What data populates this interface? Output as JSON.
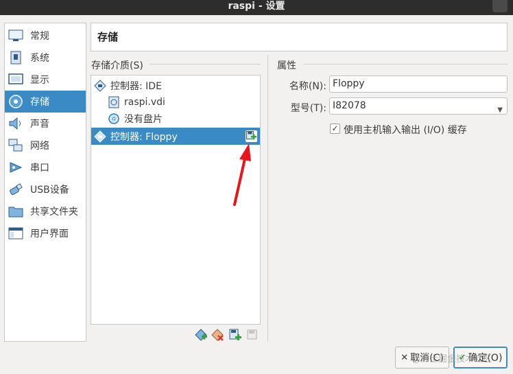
{
  "window": {
    "title": "raspi - 设置"
  },
  "sidebar": {
    "items": [
      {
        "label": "常规",
        "icon": "general-icon"
      },
      {
        "label": "系统",
        "icon": "system-chip-icon"
      },
      {
        "label": "显示",
        "icon": "monitor-icon"
      },
      {
        "label": "存储",
        "icon": "disk-icon",
        "selected": true
      },
      {
        "label": "声音",
        "icon": "speaker-icon"
      },
      {
        "label": "网络",
        "icon": "network-icon"
      },
      {
        "label": "串口",
        "icon": "serial-port-icon"
      },
      {
        "label": "USB设备",
        "icon": "usb-icon"
      },
      {
        "label": "共享文件夹",
        "icon": "folder-icon"
      },
      {
        "label": "用户界面",
        "icon": "ui-window-icon"
      }
    ]
  },
  "page": {
    "title": "存储"
  },
  "storage": {
    "media_label": "存储介质(S)",
    "tree": [
      {
        "label": "控制器: IDE",
        "icon": "controller-icon",
        "level": 0
      },
      {
        "label": "raspi.vdi",
        "icon": "hard-disk-icon",
        "level": 1
      },
      {
        "label": "没有盘片",
        "icon": "optical-disc-icon",
        "level": 1
      },
      {
        "label": "控制器: Floppy",
        "icon": "controller-icon",
        "level": 0,
        "selected": true
      }
    ],
    "toolbar": [
      "add-controller-icon",
      "remove-controller-icon",
      "add-attachment-icon",
      "remove-attachment-icon"
    ]
  },
  "properties": {
    "section_label": "属性",
    "name_label": "名称(N):",
    "name_value": "Floppy",
    "type_label": "型号(T):",
    "type_value": "I82078",
    "cache_label": "使用主机输入输出 (I/O) 缓存",
    "cache_checked": true
  },
  "buttons": {
    "cancel": "取消(C)",
    "ok": "确定(O)"
  },
  "watermark": "@稀土掘金技术社区",
  "colors": {
    "selection": "#3a8ac6",
    "titlebar": "#2d2d2d",
    "annotation_arrow": "#e8151b"
  }
}
